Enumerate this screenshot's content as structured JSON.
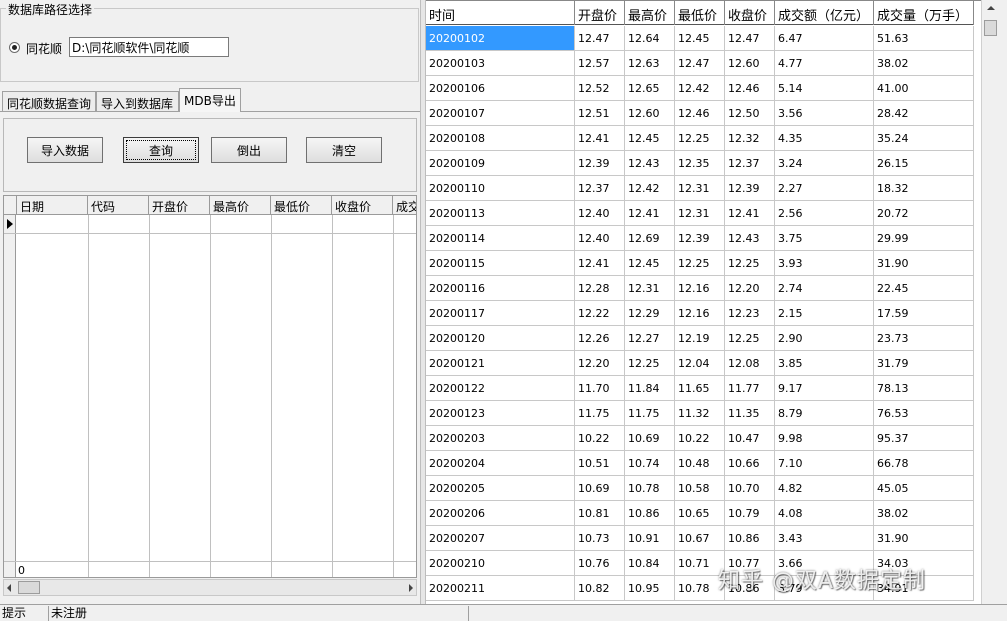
{
  "group": {
    "title": "数据库路径选择",
    "radio_label": "同花顺",
    "path_value": "D:\\同花顺软件\\同花顺"
  },
  "tabs": [
    "同花顺数据查询",
    "导入到数据库",
    "MDB导出"
  ],
  "active_tab": 2,
  "buttons": {
    "import": "导入数据",
    "query": "查询",
    "export": "倒出",
    "clear": "清空"
  },
  "left_grid": {
    "columns": [
      "日期",
      "代码",
      "开盘价",
      "最高价",
      "最低价",
      "收盘价",
      "成交"
    ],
    "row_count": "0"
  },
  "right_grid": {
    "columns": [
      "时间",
      "开盘价",
      "最高价",
      "最低价",
      "收盘价",
      "成交额（亿元）",
      "成交量（万手）"
    ],
    "rows": [
      [
        "20200102",
        "12.47",
        "12.64",
        "12.45",
        "12.47",
        "6.47",
        "51.63"
      ],
      [
        "20200103",
        "12.57",
        "12.63",
        "12.47",
        "12.60",
        "4.77",
        "38.02"
      ],
      [
        "20200106",
        "12.52",
        "12.65",
        "12.42",
        "12.46",
        "5.14",
        "41.00"
      ],
      [
        "20200107",
        "12.51",
        "12.60",
        "12.46",
        "12.50",
        "3.56",
        "28.42"
      ],
      [
        "20200108",
        "12.41",
        "12.45",
        "12.25",
        "12.32",
        "4.35",
        "35.24"
      ],
      [
        "20200109",
        "12.39",
        "12.43",
        "12.35",
        "12.37",
        "3.24",
        "26.15"
      ],
      [
        "20200110",
        "12.37",
        "12.42",
        "12.31",
        "12.39",
        "2.27",
        "18.32"
      ],
      [
        "20200113",
        "12.40",
        "12.41",
        "12.31",
        "12.41",
        "2.56",
        "20.72"
      ],
      [
        "20200114",
        "12.40",
        "12.69",
        "12.39",
        "12.43",
        "3.75",
        "29.99"
      ],
      [
        "20200115",
        "12.41",
        "12.45",
        "12.25",
        "12.25",
        "3.93",
        "31.90"
      ],
      [
        "20200116",
        "12.28",
        "12.31",
        "12.16",
        "12.20",
        "2.74",
        "22.45"
      ],
      [
        "20200117",
        "12.22",
        "12.29",
        "12.16",
        "12.23",
        "2.15",
        "17.59"
      ],
      [
        "20200120",
        "12.26",
        "12.27",
        "12.19",
        "12.25",
        "2.90",
        "23.73"
      ],
      [
        "20200121",
        "12.20",
        "12.25",
        "12.04",
        "12.08",
        "3.85",
        "31.79"
      ],
      [
        "20200122",
        "11.70",
        "11.84",
        "11.65",
        "11.77",
        "9.17",
        "78.13"
      ],
      [
        "20200123",
        "11.75",
        "11.75",
        "11.32",
        "11.35",
        "8.79",
        "76.53"
      ],
      [
        "20200203",
        "10.22",
        "10.69",
        "10.22",
        "10.47",
        "9.98",
        "95.37"
      ],
      [
        "20200204",
        "10.51",
        "10.74",
        "10.48",
        "10.66",
        "7.10",
        "66.78"
      ],
      [
        "20200205",
        "10.69",
        "10.78",
        "10.58",
        "10.70",
        "4.82",
        "45.05"
      ],
      [
        "20200206",
        "10.81",
        "10.86",
        "10.65",
        "10.79",
        "4.08",
        "38.02"
      ],
      [
        "20200207",
        "10.73",
        "10.91",
        "10.67",
        "10.86",
        "3.43",
        "31.90"
      ],
      [
        "20200210",
        "10.76",
        "10.84",
        "10.71",
        "10.77",
        "3.66",
        "34.03"
      ],
      [
        "20200211",
        "10.82",
        "10.95",
        "10.78",
        "10.86",
        "3.79",
        "34.91"
      ]
    ]
  },
  "status": {
    "hint": "提示",
    "reg": "未注册"
  },
  "watermark": "知乎 @双A数据定制",
  "colors": {
    "selection": "#3399ff",
    "background": "#f0f0f0"
  }
}
